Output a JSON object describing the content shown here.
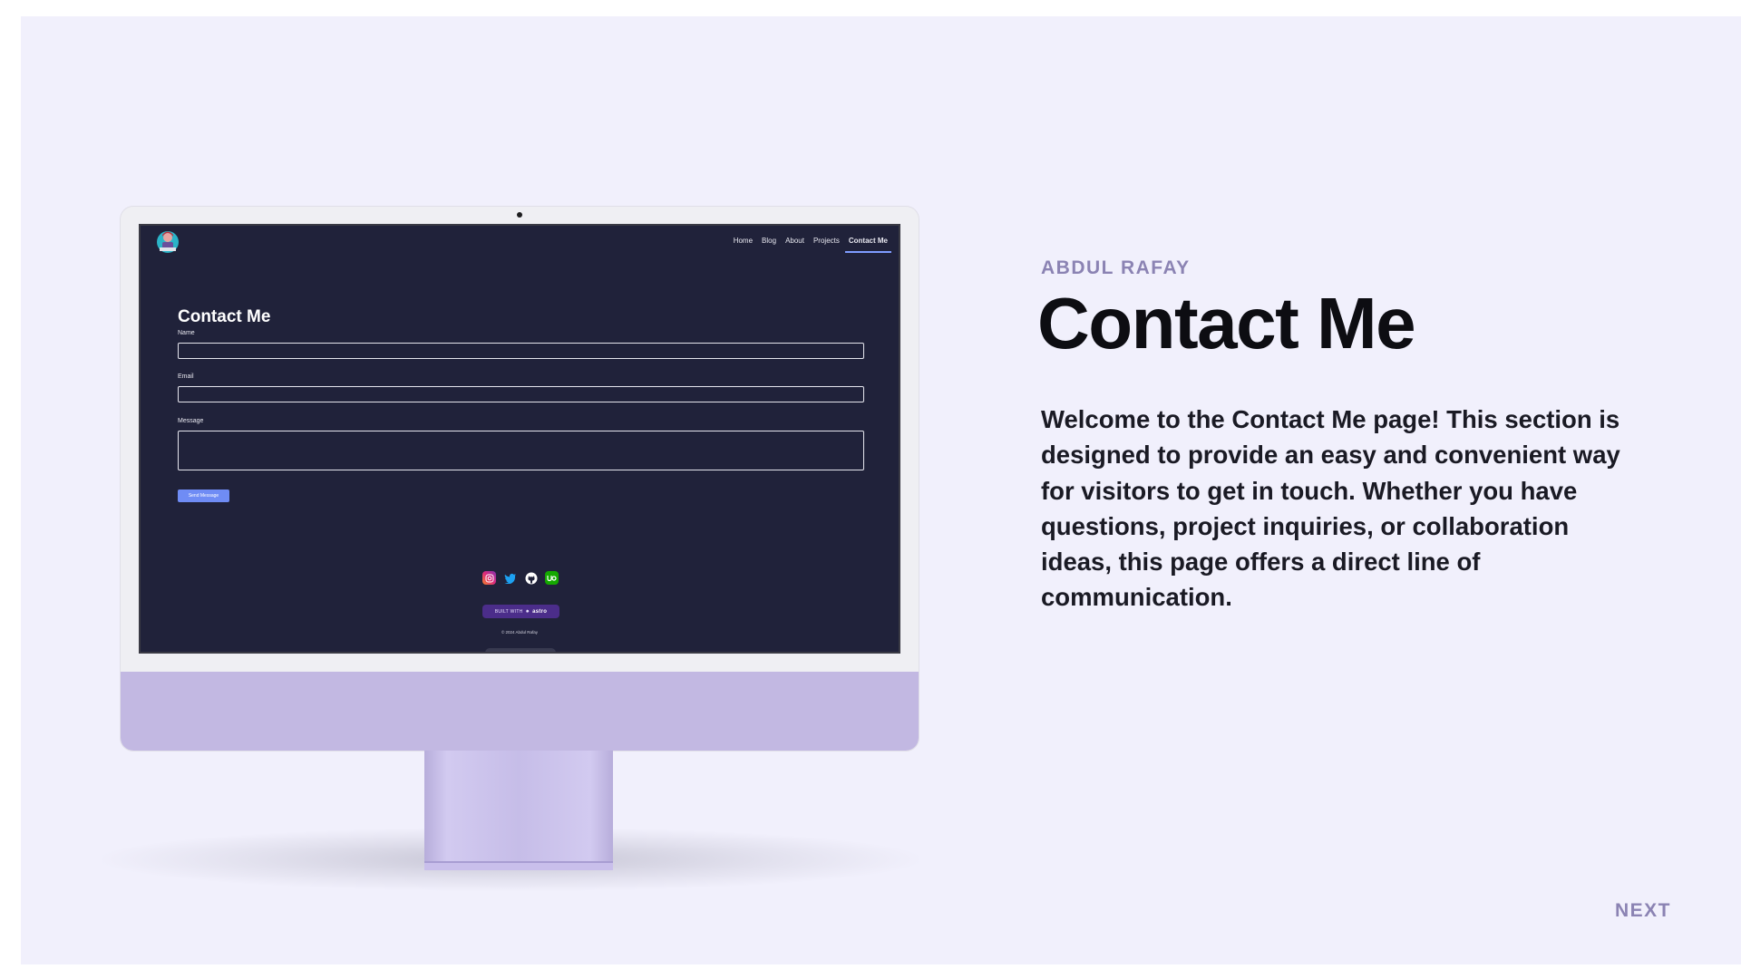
{
  "slide": {
    "author": "ABDUL RAFAY",
    "title": "Contact Me",
    "description": "Welcome to the Contact Me page! This section is designed to provide an easy and convenient way for visitors to get in touch. Whether you have questions, project inquiries, or collaboration ideas, this page offers a direct line of communication.",
    "next_label": "NEXT"
  },
  "screen": {
    "nav": {
      "items": [
        "Home",
        "Blog",
        "About",
        "Projects",
        "Contact Me"
      ],
      "active": "Contact Me"
    },
    "form": {
      "title": "Contact Me",
      "name_label": "Name",
      "name_value": "",
      "email_label": "Email",
      "email_value": "",
      "message_label": "Message",
      "message_value": "",
      "submit_label": "Send Message"
    },
    "socials": [
      "instagram-icon",
      "twitter-icon",
      "github-icon",
      "upwork-icon"
    ],
    "badge": {
      "prefix": "BUILT WITH",
      "brand": "astro"
    },
    "copyright": "© 2024 Abdul Rafay"
  },
  "colors": {
    "background": "#f1f0fc",
    "accent": "#8b83b3",
    "screen_bg": "#20223a",
    "button": "#6f8cf5",
    "monitor_purple": "#c2b8e2"
  }
}
